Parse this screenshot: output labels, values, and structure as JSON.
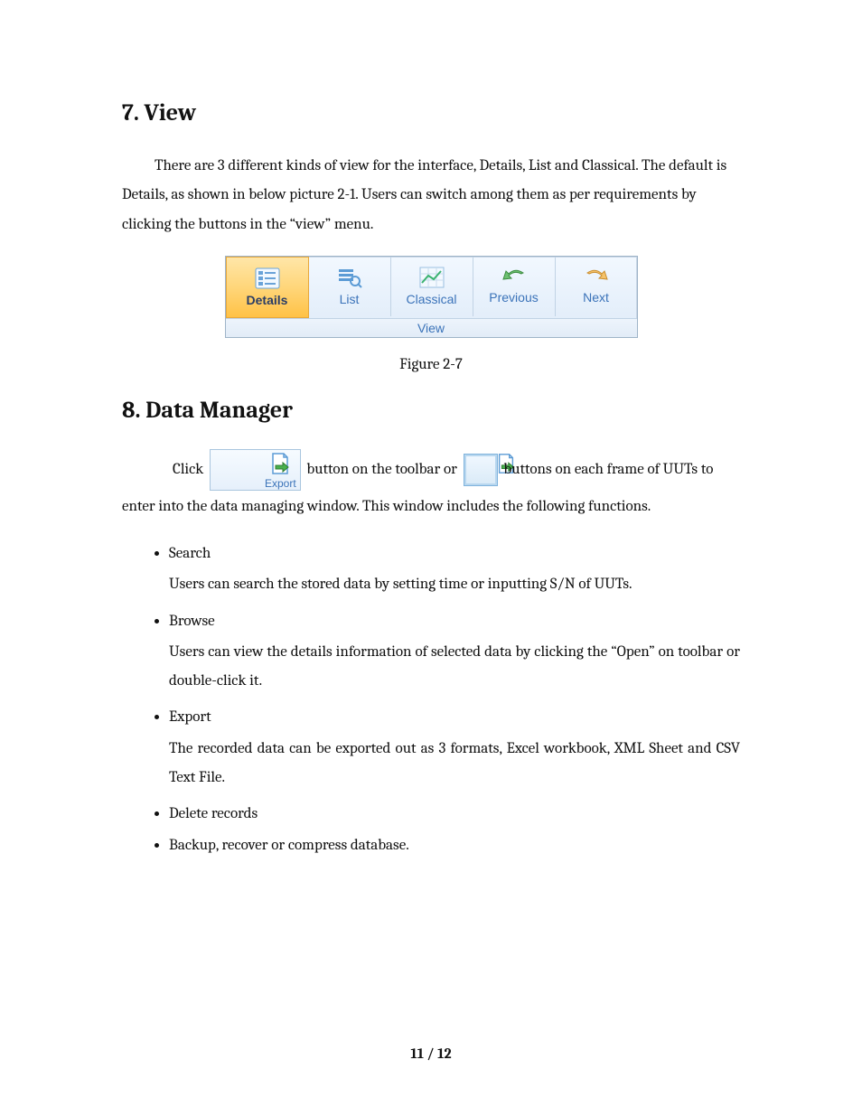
{
  "section7": {
    "heading": "7. View",
    "paragraph": "There are 3 different kinds of view for the interface, Details, List and Classical. The default is Details, as shown in below picture 2-1. Users can switch among them as per requirements by clicking the buttons in the “view” menu."
  },
  "ribbon": {
    "buttons": [
      {
        "label": "Details",
        "active": true,
        "icon": "details-list-icon"
      },
      {
        "label": "List",
        "active": false,
        "icon": "list-magnify-icon"
      },
      {
        "label": "Classical",
        "active": false,
        "icon": "chart-grid-icon"
      },
      {
        "label": "Previous",
        "active": false,
        "icon": "arrow-left-icon"
      },
      {
        "label": "Next",
        "active": false,
        "icon": "arrow-right-icon"
      }
    ],
    "group_label": "View"
  },
  "figure_caption": "Figure 2-7",
  "section8": {
    "heading": "8. Data Manager",
    "para_pre": "Click ",
    "export_btn_label": "Export",
    "para_mid": " button on the toolbar or ",
    "para_post": "buttons on each frame of UUTs to enter into the data managing window. This window includes the following functions."
  },
  "bullets": [
    {
      "title": "Search",
      "body": "Users can search the stored data by setting time or inputting S/N of UUTs."
    },
    {
      "title": "Browse",
      "body": "Users can view the details information of selected data by clicking the “Open” on toolbar or double-click it."
    },
    {
      "title": "Export",
      "body": "The recorded data can be exported out as 3 formats, Excel workbook, XML Sheet and CSV Text File."
    },
    {
      "title": "Delete records",
      "body": null
    },
    {
      "title": "Backup, recover or compress database.",
      "body": null
    }
  ],
  "footer": {
    "current": "11",
    "sep": " / ",
    "total": "12"
  }
}
